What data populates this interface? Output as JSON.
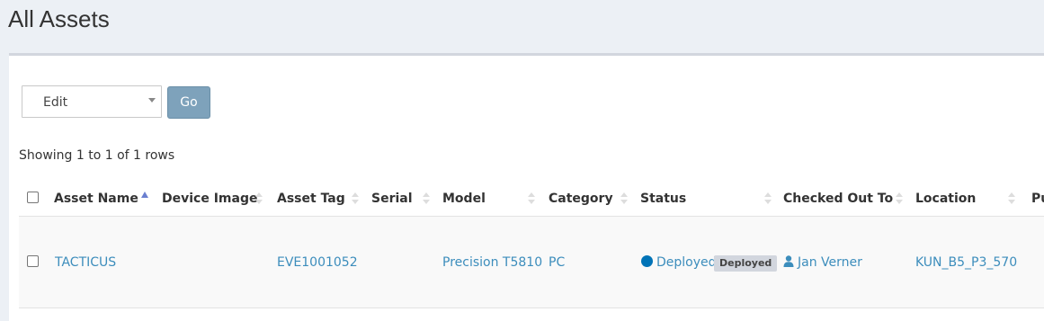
{
  "page": {
    "title": "All Assets"
  },
  "toolbar": {
    "bulk_action_value": "Edit",
    "go_label": "Go"
  },
  "table": {
    "showing_text": "Showing 1 to 1 of 1 rows",
    "columns": [
      "Asset Name",
      "Device Image",
      "Asset Tag",
      "Serial",
      "Model",
      "Category",
      "Status",
      "Checked Out To",
      "Location",
      "Pu"
    ],
    "rows": [
      {
        "asset_name": "TACTICUS",
        "device_image": "",
        "asset_tag": "EVE1001052",
        "serial": "",
        "model": "Precision T5810",
        "category": "PC",
        "status": "Deployed",
        "status_badge": "Deployed",
        "checked_out_to": "Jan Verner",
        "location": "KUN_B5_P3_570"
      }
    ]
  },
  "colors": {
    "link": "#3c8dbc",
    "go_button": "#7ea2bb",
    "status_deployed": "#0073b7",
    "page_bg": "#ecf0f5"
  },
  "icons": {
    "status": "circle-icon",
    "user": "user-icon",
    "sort": "sort-icon"
  }
}
